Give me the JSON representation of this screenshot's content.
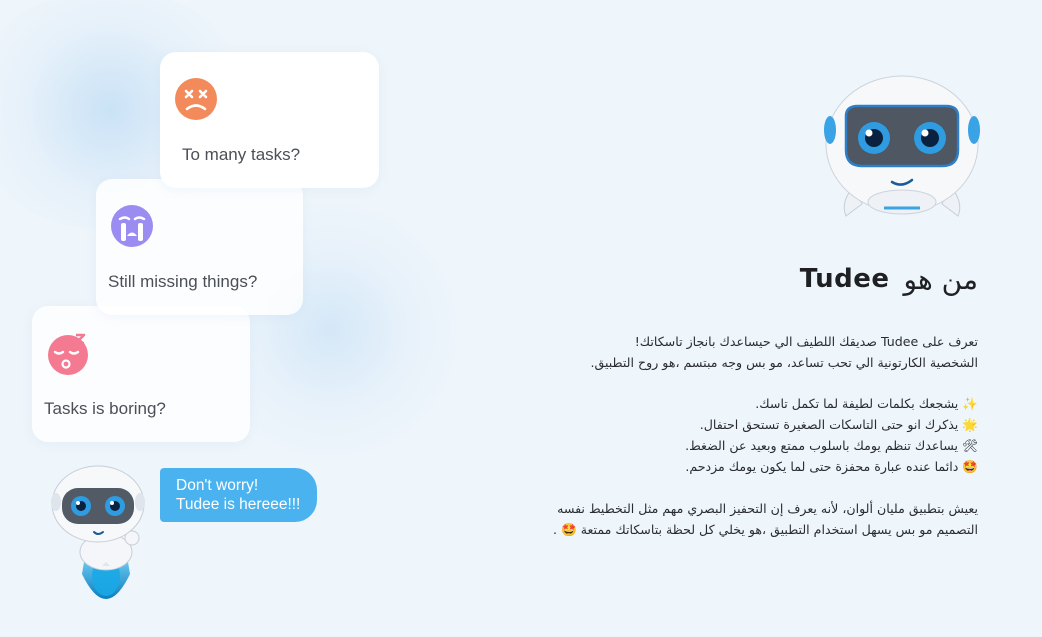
{
  "cards": [
    {
      "text": "To many tasks?",
      "face": "dizzy-face-icon",
      "color": "#f28a5b"
    },
    {
      "text": "Still missing things?",
      "face": "crying-face-icon",
      "color": "#9b8cf2"
    },
    {
      "text": "Tasks is boring?",
      "face": "sleeping-face-icon",
      "color": "#f47a92"
    }
  ],
  "bubble": {
    "line1": "Don't worry!",
    "line2": "Tudee is hereee!!!",
    "color": "#4ab3ef"
  },
  "title": {
    "arabic": "من هو",
    "brand": "Tudee"
  },
  "intro": [
    "تعرف على Tudee  صديقك اللطيف الي حيساعدك بانجاز تاسكاتك!",
    "الشخصية الكارتونية الي تحب تساعد، مو بس وجه مبتسم ،هو روح التطبيق."
  ],
  "features": [
    {
      "icon": "sparkles-icon",
      "glyph": "✨",
      "text": "يشجعك بكلمات لطيفة لما تكمل تاسك."
    },
    {
      "icon": "star-burst-icon",
      "glyph": "🌟",
      "text": "يذكرك انو حتى التاسكات الصغيرة تستحق احتفال."
    },
    {
      "icon": "tools-icon",
      "glyph": "🛠",
      "text": "يساعدك تنظم يومك باسلوب ممتع وبعيد عن الضغط."
    },
    {
      "icon": "star-eyes-icon",
      "glyph": "🤩",
      "text": "دائما عنده عبارة محفزة حتى لما يكون يومك مزدحم."
    }
  ],
  "outro": {
    "line1": "يعيش بتطبيق مليان ألوان، لأنه يعرف إن التحفيز البصري مهم مثل التخطيط نفسه",
    "line2": "التصميم مو بس يسهل استخدام التطبيق ،هو يخلي كل لحظة بتاسكاتك ممتعة",
    "emoji": "🤩"
  },
  "colors": {
    "background": "#eef5fb",
    "robot_eye": "#2f9be0",
    "robot_body": "#ffffff"
  }
}
